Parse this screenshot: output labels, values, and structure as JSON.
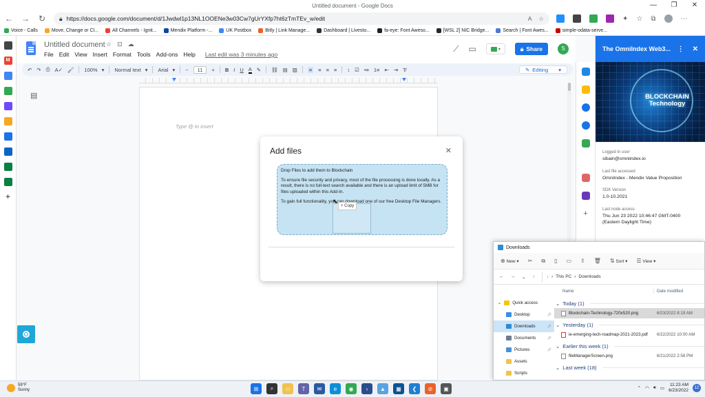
{
  "browser": {
    "tab_title": "Untitled document - Google Docs",
    "url": "https://docs.google.com/document/d/1Jwdwl1p13NL1OOENe3w03Cw7gUrYXfp7ht6zTmTEv_w/edit",
    "window_controls": [
      "—",
      "❐",
      "✕"
    ]
  },
  "bookmarks": [
    {
      "label": "Voice - Calls",
      "color": "#34a853"
    },
    {
      "label": "Move, Change or Cl...",
      "color": "#f7a823"
    },
    {
      "label": "All Channels - Ignit...",
      "color": "#ea4335"
    },
    {
      "label": "Mendix Platform -...",
      "color": "#0d47a1"
    },
    {
      "label": "UK Postbox",
      "color": "#4285f4"
    },
    {
      "label": "Bitly | Link Manage...",
      "color": "#ee6123"
    },
    {
      "label": "Dashboard | Livesto...",
      "color": "#333333"
    },
    {
      "label": "fa-eye: Font Aweso...",
      "color": "#222222"
    },
    {
      "label": "[WSL 2] NIC Bridge...",
      "color": "#24292e"
    },
    {
      "label": "Search | Font Awes...",
      "color": "#4a7bd1"
    },
    {
      "label": "simple-odata-serve...",
      "color": "#cc0000"
    }
  ],
  "docs": {
    "title": "Untitled document",
    "menus": [
      "File",
      "Edit",
      "View",
      "Insert",
      "Format",
      "Tools",
      "Add-ons",
      "Help"
    ],
    "last_edit": "Last edit was 3 minutes ago",
    "share_label": "Share",
    "avatar_letter": "S",
    "toolbar": {
      "zoom": "100%",
      "style": "Normal text",
      "font": "Arial",
      "size": "11",
      "mode": "Editing"
    },
    "placeholder": "Type @ to insert"
  },
  "dialog": {
    "title": "Add files",
    "drop_heading": "Drop Files to add them to Blockchain",
    "para1": "To ensure file security and privacy, most of the file processing is done locally. As a result, there is no full-text search available and there is an upload limit of 5MB for files uploaded within this Add-In.",
    "para2": "To gain full functionality, you can download one of our free Desktop File Managers.",
    "copy_tip": "+ Copy"
  },
  "addon": {
    "title": "The OmniIndex Web3...",
    "banner_text": "BLOCKCHAIN Technology",
    "fields": [
      {
        "label": "Logged in user",
        "value": "sibain@omniindex.io"
      },
      {
        "label": "Last file accessed",
        "value": "OmniIndex - Mendix Value Proposition"
      },
      {
        "label": "SDK Version",
        "value": "1.0-10.2021"
      },
      {
        "label": "Last node access",
        "value": "Thu Jun 23 2022 10:46:47 GMT-0400 (Eastern Daylight Time)"
      }
    ]
  },
  "explorer": {
    "title": "Downloads",
    "commands": {
      "new": "New",
      "sort": "Sort",
      "view": "View"
    },
    "path": [
      "This PC",
      "Downloads"
    ],
    "nav": [
      {
        "label": "Quick access",
        "color": "#f7c600",
        "top": true
      },
      {
        "label": "Desktop",
        "color": "#3a8ee6"
      },
      {
        "label": "Downloads",
        "color": "#2e8bd6",
        "selected": true
      },
      {
        "label": "Documents",
        "color": "#6d7c8c"
      },
      {
        "label": "Pictures",
        "color": "#4a90d9"
      },
      {
        "label": "Assets",
        "color": "#f2c14e"
      },
      {
        "label": "Scripts",
        "color": "#f2c14e"
      }
    ],
    "columns": {
      "name": "Name",
      "date": "Date modified"
    },
    "groups": [
      {
        "label": "Today (1)",
        "files": [
          {
            "name": "Blockchain-Technology-720x520.png",
            "date": "6/23/2022 8:19 AM",
            "selected": true
          }
        ]
      },
      {
        "label": "Yesterday (1)",
        "files": [
          {
            "name": "ie-emerging-tech-roadmap-2021-2023.pdf",
            "date": "6/22/2022 10:00 AM",
            "pdf": true
          }
        ]
      },
      {
        "label": "Earlier this week (1)",
        "files": [
          {
            "name": "fileManagerScreen.png",
            "date": "6/21/2022 2:58 PM"
          }
        ]
      },
      {
        "label": "Last week (18)",
        "files": []
      }
    ]
  },
  "taskbar": {
    "temperature": "59°F",
    "condition": "Sunny",
    "time": "11:23 AM",
    "date": "6/23/2022",
    "notifications": "12",
    "apps": [
      {
        "name": "start-icon",
        "color": "#1a73e8",
        "glyph": "⊞"
      },
      {
        "name": "search-icon",
        "color": "#333333",
        "glyph": "⌕"
      },
      {
        "name": "file-explorer-icon",
        "color": "#f2c14e",
        "glyph": "▭"
      },
      {
        "name": "teams-icon",
        "color": "#6264a7",
        "glyph": "T"
      },
      {
        "name": "mail-icon",
        "color": "#2c5aa0",
        "glyph": "✉"
      },
      {
        "name": "edge-icon",
        "color": "#0c8fd6",
        "glyph": "e"
      },
      {
        "name": "chrome-icon",
        "color": "#34a853",
        "glyph": "◉"
      },
      {
        "name": "powershell-icon",
        "color": "#2a4d8f",
        "glyph": "›"
      },
      {
        "name": "photos-icon",
        "color": "#5ba3e0",
        "glyph": "▲"
      },
      {
        "name": "store-icon",
        "color": "#0b5394",
        "glyph": "▦"
      },
      {
        "name": "vscode-icon",
        "color": "#1f7fd2",
        "glyph": "❮"
      },
      {
        "name": "brave-icon",
        "color": "#e8632b",
        "glyph": "⊘"
      },
      {
        "name": "terminal-icon",
        "color": "#555555",
        "glyph": "▣"
      }
    ]
  }
}
